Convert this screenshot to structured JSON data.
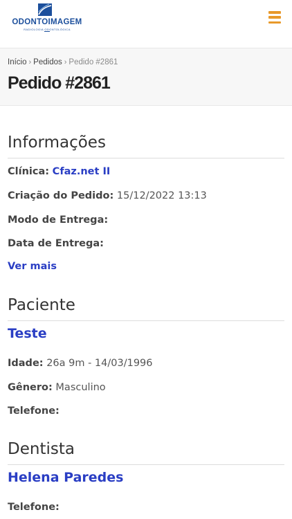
{
  "brand": {
    "name": "ODONTOIMAGEM",
    "tagline": "RADIOLOGIA ODONTOLÓGICA",
    "color": "#1c4f9c"
  },
  "nav": {
    "menu_icon": "hamburger-icon",
    "menu_color": "#e8992a"
  },
  "breadcrumb": {
    "items": [
      "Início",
      "Pedidos",
      "Pedido #2861"
    ],
    "separator_icon": "chevron-right-icon"
  },
  "page": {
    "title": "Pedido #2861"
  },
  "info": {
    "heading": "Informações",
    "clinic_label": "Clínica:",
    "clinic_value": "Cfaz.net II",
    "created_label": "Criação do Pedido:",
    "created_value": "15/12/2022 13:13",
    "delivery_mode_label": "Modo de Entrega:",
    "delivery_date_label": "Data de Entrega:",
    "more_link": "Ver mais"
  },
  "patient": {
    "heading": "Paciente",
    "name": "Teste",
    "age_label": "Idade:",
    "age_value": "26a 9m - 14/03/1996",
    "gender_label": "Gênero:",
    "gender_value": "Masculino",
    "phone_label": "Telefone:"
  },
  "dentist": {
    "heading": "Dentista",
    "name": "Helena Paredes",
    "phone_label": "Telefone:"
  },
  "colors": {
    "link": "#2a3ec4",
    "accent": "#e8992a"
  }
}
